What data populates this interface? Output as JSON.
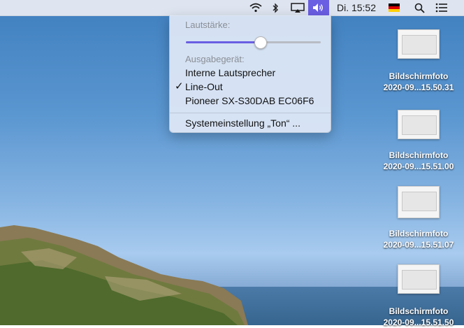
{
  "menubar": {
    "clock": "Di. 15:52",
    "icons": [
      "wifi-icon",
      "bluetooth-icon",
      "airplay-icon",
      "volume-icon",
      "flag-germany-icon",
      "search-icon",
      "notification-center-icon"
    ]
  },
  "sound_menu": {
    "volume_header": "Lautstärke:",
    "volume_level_percent": 55,
    "output_header": "Ausgabegerät:",
    "devices": [
      {
        "label": "Interne Lautsprecher",
        "selected": false
      },
      {
        "label": "Line-Out",
        "selected": true
      },
      {
        "label": "Pioneer SX-S30DAB EC06F6",
        "selected": false
      }
    ],
    "settings_label": "Systemeinstellung „Ton“ ..."
  },
  "desktop": {
    "files": [
      {
        "name": "Bildschirmfoto",
        "date": "2020-09...15.50.31"
      },
      {
        "name": "Bildschirmfoto",
        "date": "2020-09...15.51.00"
      },
      {
        "name": "Bildschirmfoto",
        "date": "2020-09...15.51.07"
      },
      {
        "name": "Bildschirmfoto",
        "date": "2020-09...15.51.50"
      }
    ]
  },
  "colors": {
    "accent": "#6a5ee3",
    "menubar": "#eceef4"
  }
}
